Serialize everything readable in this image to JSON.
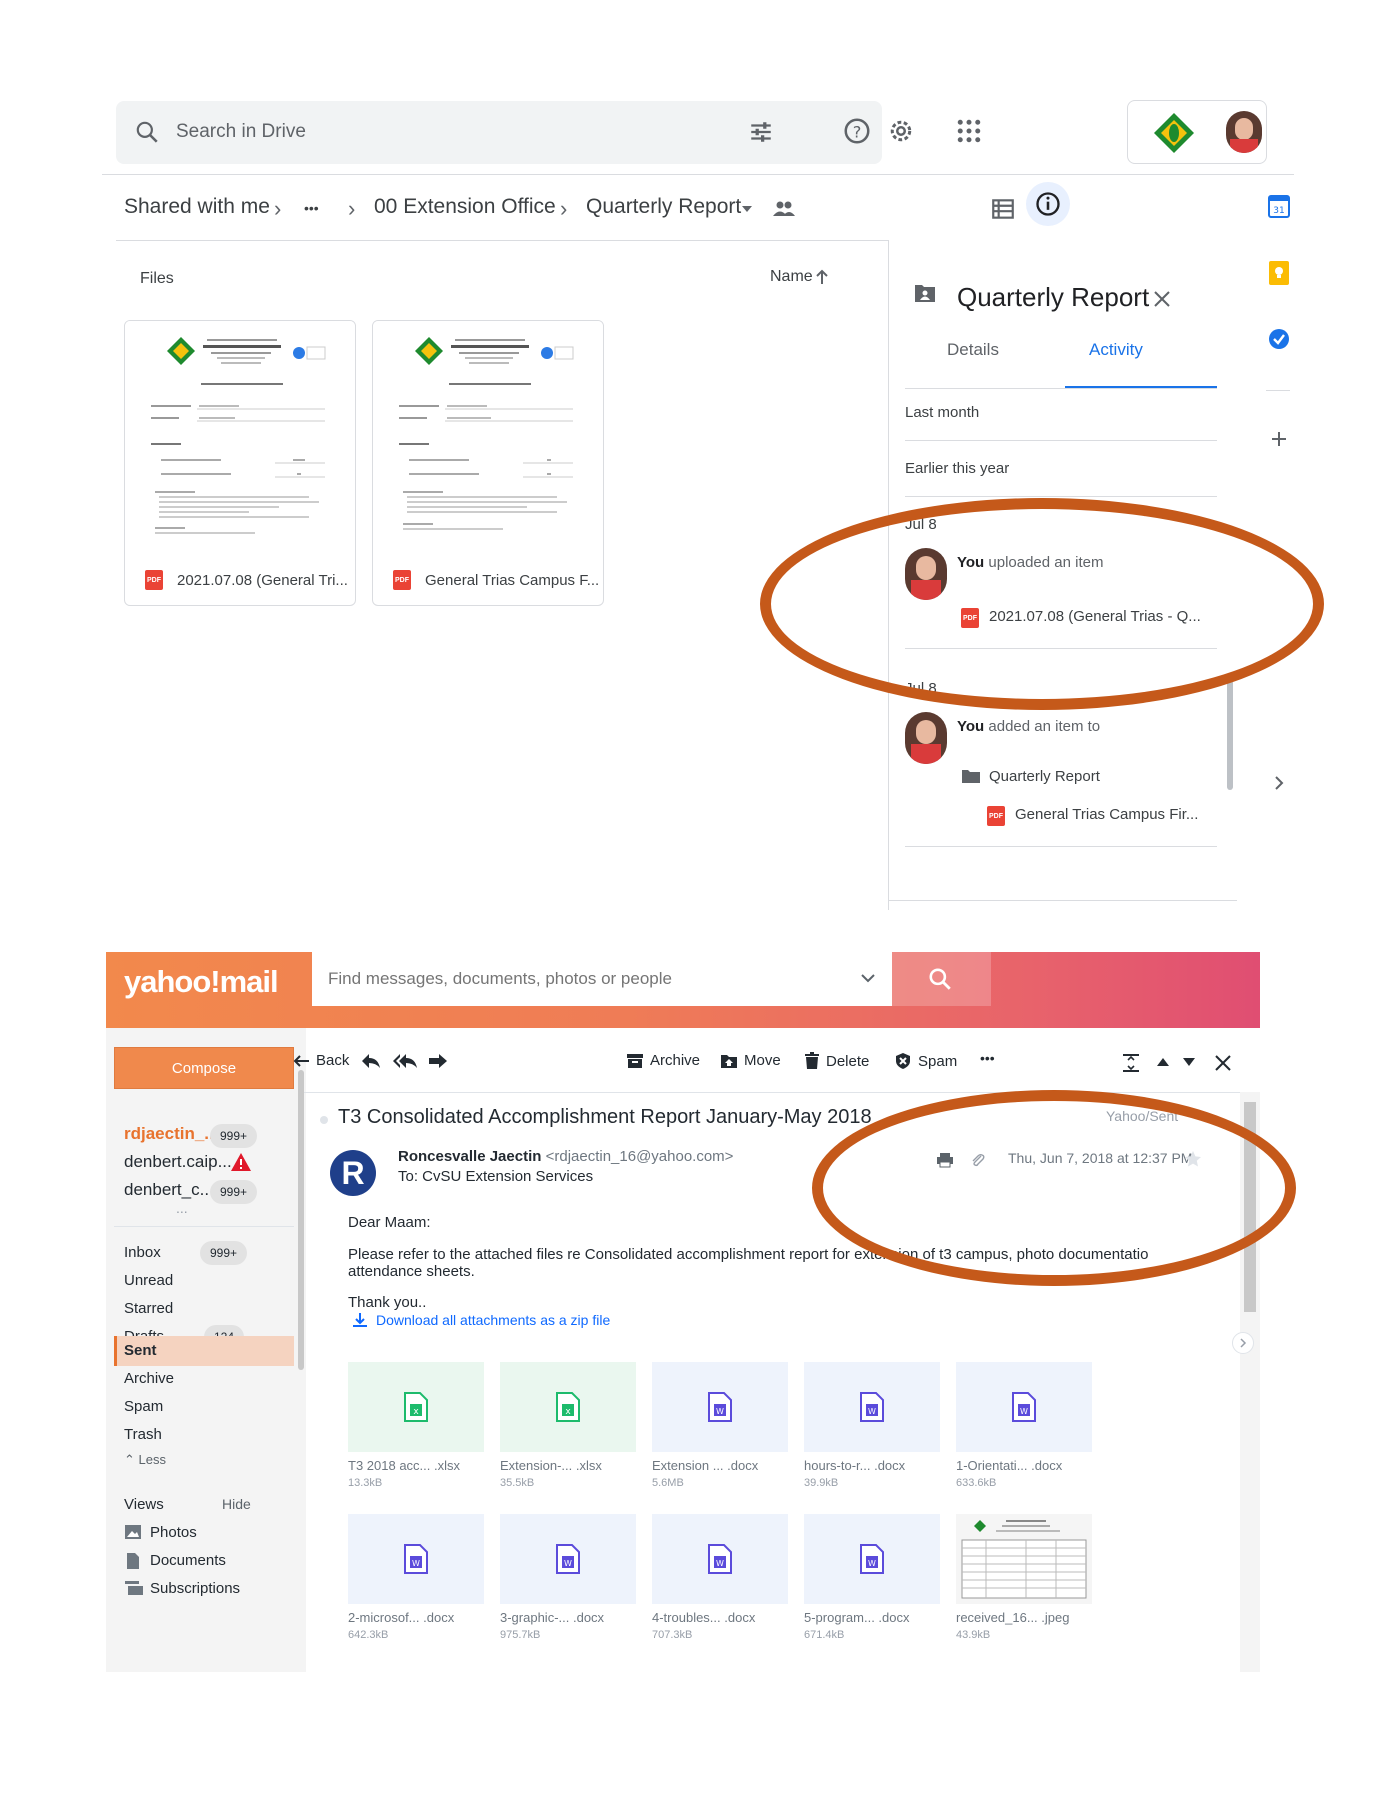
{
  "drive": {
    "search_placeholder": "Search in Drive",
    "breadcrumb": {
      "root": "Shared with me",
      "ellipsis": "•••",
      "folder": "00 Extension Office",
      "current": "Quarterly Report"
    },
    "files_label": "Files",
    "sort_label": "Name",
    "files": [
      {
        "name": "2021.07.08 (General Tri..."
      },
      {
        "name": "General Trias Campus F..."
      }
    ],
    "panel": {
      "title": "Quarterly Report",
      "tabs": [
        {
          "label": "Details"
        },
        {
          "label": "Activity"
        }
      ],
      "active_tab": "Activity",
      "sections": {
        "last_month": "Last month",
        "earlier": "Earlier this year"
      },
      "activities": [
        {
          "date": "Jul 8",
          "actor": "You",
          "action": "uploaded an item",
          "file": "2021.07.08 (General Trias - Q..."
        },
        {
          "date": "Jul 8",
          "actor": "You",
          "action": "added an item to",
          "folder": "Quarterly Report",
          "file": "General Trias Campus Fir..."
        }
      ]
    },
    "accent_color": "#1a73e8"
  },
  "yahoo": {
    "logo": "yahoo!mail",
    "search_placeholder": "Find messages, documents, photos or people",
    "compose_label": "Compose",
    "accounts": [
      {
        "name": "rdjaectin_...",
        "count": "999+"
      },
      {
        "name": "denbert.caip...",
        "count": ""
      },
      {
        "name": "denbert_c...",
        "count": "999+"
      }
    ],
    "more_label": "...",
    "folders": [
      {
        "name": "Inbox",
        "count": "999+"
      },
      {
        "name": "Unread",
        "count": ""
      },
      {
        "name": "Starred",
        "count": ""
      },
      {
        "name": "Drafts",
        "count": "124"
      },
      {
        "name": "Sent",
        "count": ""
      },
      {
        "name": "Archive",
        "count": ""
      },
      {
        "name": "Spam",
        "count": ""
      },
      {
        "name": "Trash",
        "count": ""
      }
    ],
    "less_label": "Less",
    "views_label": "Views",
    "hide_label": "Hide",
    "views": [
      {
        "name": "Photos"
      },
      {
        "name": "Documents"
      },
      {
        "name": "Subscriptions"
      }
    ],
    "toolbar": {
      "back": "Back",
      "archive": "Archive",
      "move": "Move",
      "delete": "Delete",
      "spam": "Spam",
      "more": "•••"
    },
    "message": {
      "subject": "T3 Consolidated Accomplishment Report January-May 2018",
      "folder_tag": "Yahoo/Sent",
      "sender_initial": "R",
      "sender_name": "Roncesvalle Jaectin",
      "sender_email": "<rdjaectin_16@yahoo.com>",
      "to": "To: CvSU Extension Services",
      "date": "Thu, Jun 7, 2018 at 12:37 PM",
      "greeting": "Dear Maam:",
      "body_line1": "Please refer to the attached files re Consolidated accomplishment report for extension of t3 campus, photo documentation and",
      "body_line2": "attendance sheets.",
      "closing": "Thank you..",
      "download_all": "Download all attachments as a zip file"
    },
    "attachments": [
      {
        "name": "T3 2018 acc... .xlsx",
        "size": "13.3kB",
        "type": "xlsx"
      },
      {
        "name": "Extension-... .xlsx",
        "size": "35.5kB",
        "type": "xlsx"
      },
      {
        "name": "Extension ... .docx",
        "size": "5.6MB",
        "type": "docx"
      },
      {
        "name": "hours-to-r... .docx",
        "size": "39.9kB",
        "type": "docx"
      },
      {
        "name": "1-Orientati... .docx",
        "size": "633.6kB",
        "type": "docx"
      },
      {
        "name": "2-microsof... .docx",
        "size": "642.3kB",
        "type": "docx"
      },
      {
        "name": "3-graphic-... .docx",
        "size": "975.7kB",
        "type": "docx"
      },
      {
        "name": "4-troubles... .docx",
        "size": "707.3kB",
        "type": "docx"
      },
      {
        "name": "5-program... .docx",
        "size": "671.4kB",
        "type": "docx"
      },
      {
        "name": "received_16... .jpeg",
        "size": "43.9kB",
        "type": "jpeg"
      }
    ],
    "brand_color": "#f0894c",
    "highlight_color": "#c5591a"
  }
}
